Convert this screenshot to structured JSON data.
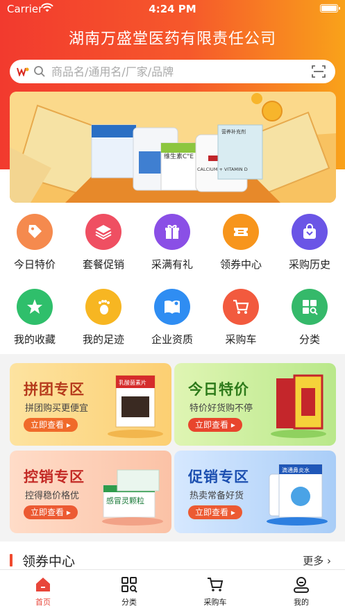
{
  "status_bar": {
    "carrier": "Carrier",
    "time": "4:24 PM"
  },
  "header": {
    "company_name": "湖南万盛堂医药有限责任公司"
  },
  "search": {
    "placeholder": "商品名/通用名/厂家/品牌"
  },
  "banner": {
    "labels": [
      "维生素C\"E",
      "CALCIUM + VITAMIN D",
      "营养补充剂"
    ]
  },
  "quick_menu": [
    {
      "label": "今日特价",
      "icon": "tag-icon",
      "color": "#f58a4e"
    },
    {
      "label": "套餐促销",
      "icon": "layers-icon",
      "color": "#ef4f62"
    },
    {
      "label": "采满有礼",
      "icon": "gift-icon",
      "color": "#8a4fe6"
    },
    {
      "label": "领券中心",
      "icon": "ticket-icon",
      "color": "#f7951c"
    },
    {
      "label": "采购历史",
      "icon": "bag-icon",
      "color": "#6a55e6"
    },
    {
      "label": "我的收藏",
      "icon": "star-icon",
      "color": "#2fbf6b"
    },
    {
      "label": "我的足迹",
      "icon": "footprint-icon",
      "color": "#f7b622"
    },
    {
      "label": "企业资质",
      "icon": "book-icon",
      "color": "#2f8df2"
    },
    {
      "label": "采购车",
      "icon": "cart-icon",
      "color": "#f25a3e"
    },
    {
      "label": "分类",
      "icon": "category-icon",
      "color": "#35b96a"
    }
  ],
  "promos": [
    {
      "title": "拼团专区",
      "subtitle": "拼团购买更便宜",
      "button": "立即查看",
      "product": "乳酸菌素片"
    },
    {
      "title": "今日特价",
      "subtitle": "特价好货购不停",
      "button": "立即查看",
      "product": ""
    },
    {
      "title": "控销专区",
      "subtitle": "控得稳价格优",
      "button": "立即查看",
      "product": "感冒灵颗粒"
    },
    {
      "title": "促销专区",
      "subtitle": "热卖常备好货",
      "button": "立即查看",
      "product": "滴通鼻炎水"
    }
  ],
  "coupon_section": {
    "title": "领券中心",
    "more": "更多"
  },
  "tabbar": [
    {
      "label": "首页",
      "icon": "home-icon",
      "active": true
    },
    {
      "label": "分类",
      "icon": "category-grid-icon",
      "active": false
    },
    {
      "label": "采购车",
      "icon": "cart-icon",
      "active": false
    },
    {
      "label": "我的",
      "icon": "profile-icon",
      "active": false
    }
  ],
  "colors": {
    "accent": "#f04a2e",
    "tab_active": "#e8463a"
  }
}
